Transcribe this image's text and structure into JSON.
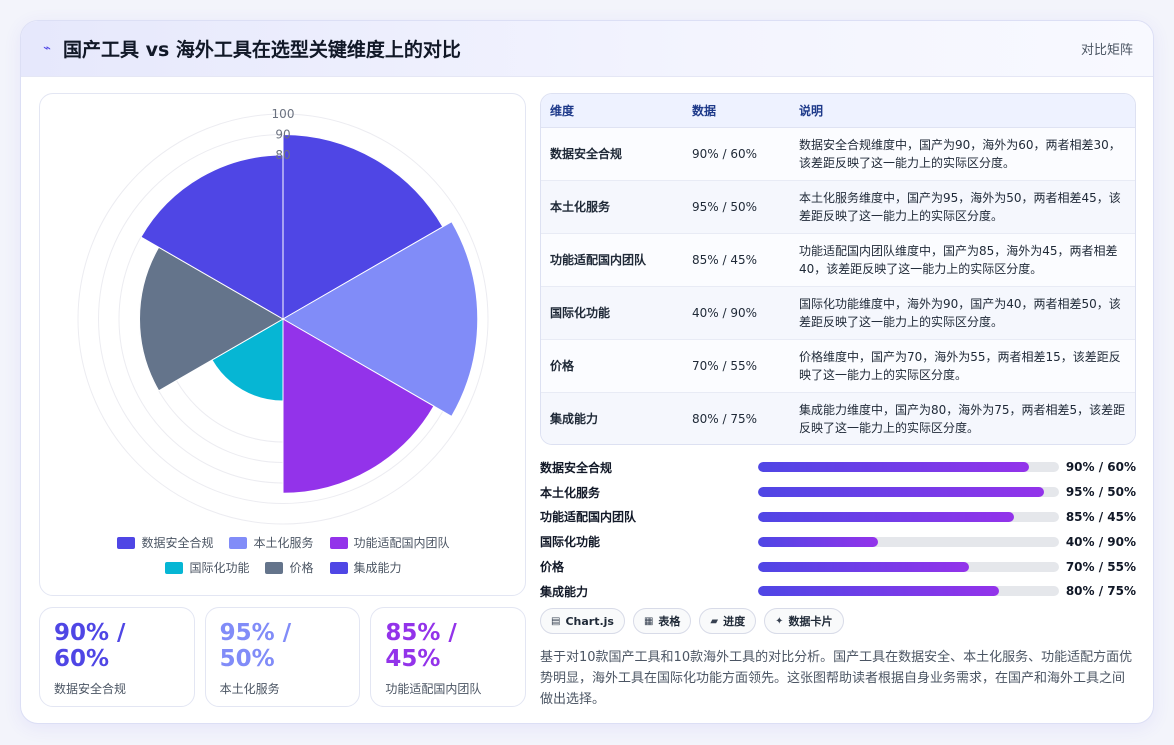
{
  "header": {
    "icon": "chart-line-icon",
    "title": "国产工具 vs 海外工具在选型关键维度上的对比",
    "tag": "对比矩阵"
  },
  "chart_data": {
    "type": "polarArea",
    "categories": [
      "数据安全合规",
      "本土化服务",
      "功能适配国内团队",
      "国际化功能",
      "价格",
      "集成能力"
    ],
    "values": [
      90,
      95,
      85,
      40,
      70,
      80
    ],
    "colors": [
      "#4f46e5",
      "#818cf8",
      "#9333ea",
      "#06b6d4",
      "#64748b",
      "#4f46e5"
    ],
    "r_ticks": [
      80,
      90,
      100
    ],
    "rlim": [
      0,
      100
    ],
    "legend": "bottom"
  },
  "legend": [
    {
      "label": "数据安全合规",
      "color": "#4f46e5"
    },
    {
      "label": "本土化服务",
      "color": "#818cf8"
    },
    {
      "label": "功能适配国内团队",
      "color": "#9333ea"
    },
    {
      "label": "国际化功能",
      "color": "#06b6d4"
    },
    {
      "label": "价格",
      "color": "#64748b"
    },
    {
      "label": "集成能力",
      "color": "#4f46e5"
    }
  ],
  "stats": [
    {
      "value": "90% / 60%",
      "label": "数据安全合规",
      "color": "#4f46e5"
    },
    {
      "value": "95% / 50%",
      "label": "本土化服务",
      "color": "#818cf8"
    },
    {
      "value": "85% / 45%",
      "label": "功能适配国内团队",
      "color": "#9333ea"
    }
  ],
  "table": {
    "headers": [
      "维度",
      "数据",
      "说明"
    ],
    "rows": [
      [
        "数据安全合规",
        "90% / 60%",
        "数据安全合规维度中，国产为90，海外为60，两者相差30，该差距反映了这一能力上的实际区分度。"
      ],
      [
        "本土化服务",
        "95% / 50%",
        "本土化服务维度中，国产为95，海外为50，两者相差45，该差距反映了这一能力上的实际区分度。"
      ],
      [
        "功能适配国内团队",
        "85% / 45%",
        "功能适配国内团队维度中，国产为85，海外为45，两者相差40，该差距反映了这一能力上的实际区分度。"
      ],
      [
        "国际化功能",
        "40% / 90%",
        "国际化功能维度中，海外为90，国产为40，两者相差50，该差距反映了这一能力上的实际区分度。"
      ],
      [
        "价格",
        "70% / 55%",
        "价格维度中，国产为70，海外为55，两者相差15，该差距反映了这一能力上的实际区分度。"
      ],
      [
        "集成能力",
        "80% / 75%",
        "集成能力维度中，国产为80，海外为75，两者相差5，该差距反映了这一能力上的实际区分度。"
      ]
    ]
  },
  "progress": [
    {
      "label": "数据安全合规",
      "value": 90,
      "text": "90% / 60%"
    },
    {
      "label": "本土化服务",
      "value": 95,
      "text": "95% / 50%"
    },
    {
      "label": "功能适配国内团队",
      "value": 85,
      "text": "85% / 45%"
    },
    {
      "label": "国际化功能",
      "value": 40,
      "text": "40% / 90%"
    },
    {
      "label": "价格",
      "value": 70,
      "text": "70% / 55%"
    },
    {
      "label": "集成能力",
      "value": 80,
      "text": "80% / 75%"
    }
  ],
  "chips": [
    {
      "icon": "chart-icon",
      "glyph": "▤",
      "label": "Chart.js"
    },
    {
      "icon": "table-icon",
      "glyph": "▦",
      "label": "表格"
    },
    {
      "icon": "progress-icon",
      "glyph": "▰",
      "label": "进度"
    },
    {
      "icon": "sparkle-icon",
      "glyph": "✦",
      "label": "数据卡片"
    }
  ],
  "description": "基于对10款国产工具和10款海外工具的对比分析。国产工具在数据安全、本土化服务、功能适配方面优势明显，海外工具在国际化功能方面领先。这张图帮助读者根据自身业务需求，在国产和海外工具之间做出选择。"
}
